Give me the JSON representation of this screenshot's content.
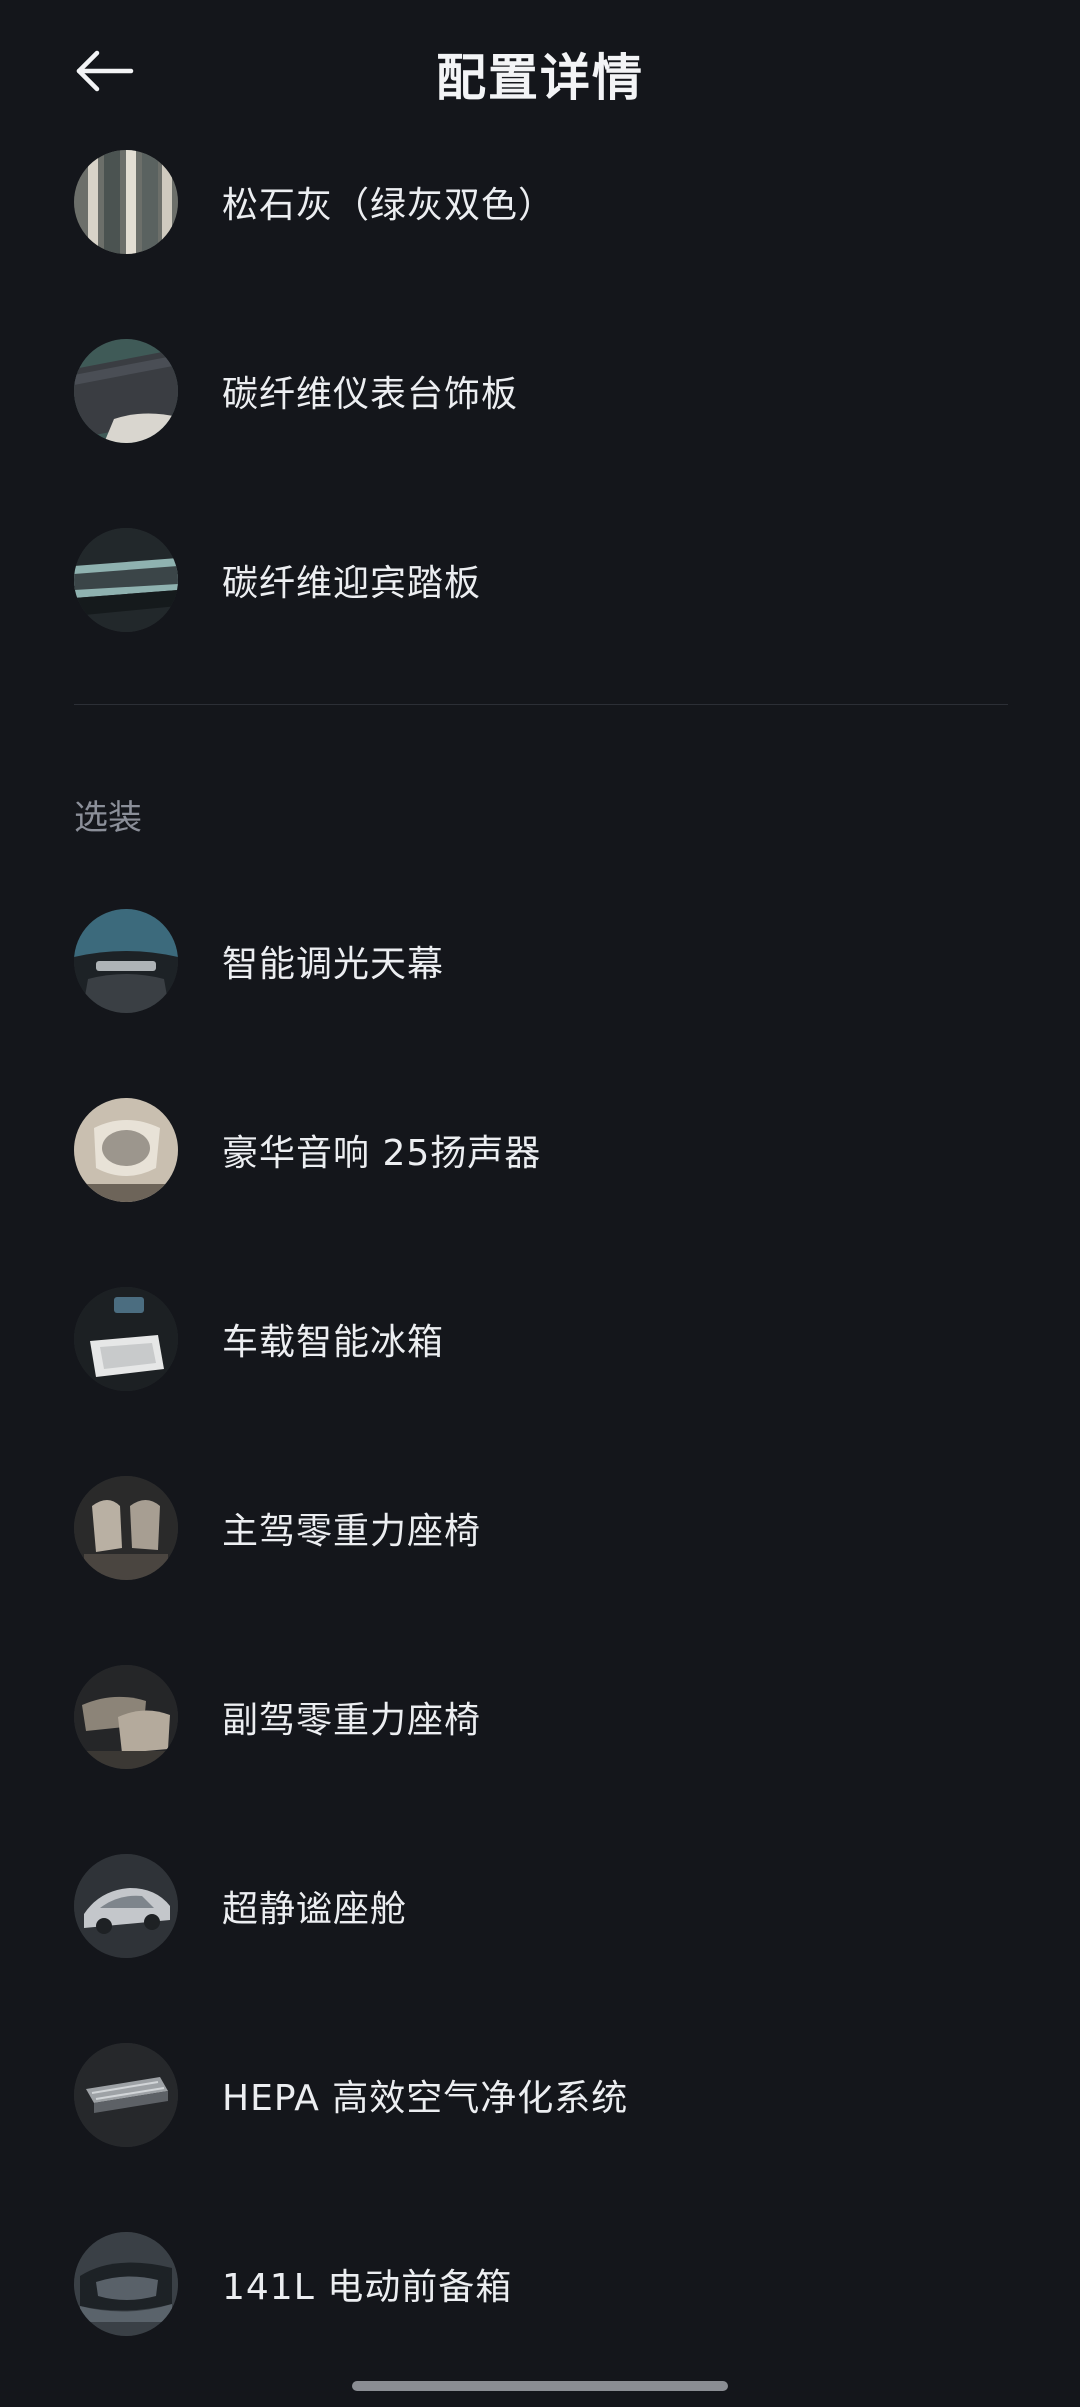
{
  "header": {
    "title": "配置详情",
    "back_icon": "arrow-left-icon"
  },
  "standard_items": [
    {
      "label": "松石灰（绿灰双色）",
      "icon": "interior-color-swatch"
    },
    {
      "label": "碳纤维仪表台饰板",
      "icon": "carbon-dashboard-trim"
    },
    {
      "label": "碳纤维迎宾踏板",
      "icon": "carbon-door-sill"
    }
  ],
  "optional_section": {
    "title": "选装",
    "items": [
      {
        "label": "智能调光天幕",
        "icon": "dimming-sunroof"
      },
      {
        "label": "豪华音响 25扬声器",
        "icon": "speaker"
      },
      {
        "label": "车载智能冰箱",
        "icon": "fridge"
      },
      {
        "label": "主驾零重力座椅",
        "icon": "driver-seat"
      },
      {
        "label": "副驾零重力座椅",
        "icon": "passenger-seat"
      },
      {
        "label": "超静谧座舱",
        "icon": "quiet-cabin"
      },
      {
        "label": "HEPA 高效空气净化系统",
        "icon": "hepa-filter"
      },
      {
        "label": "141L 电动前备箱",
        "icon": "front-trunk"
      }
    ]
  },
  "colors": {
    "background": "#14161b",
    "text": "#eceef1",
    "section_title": "#8b8f99",
    "divider": "#2c2f36"
  }
}
